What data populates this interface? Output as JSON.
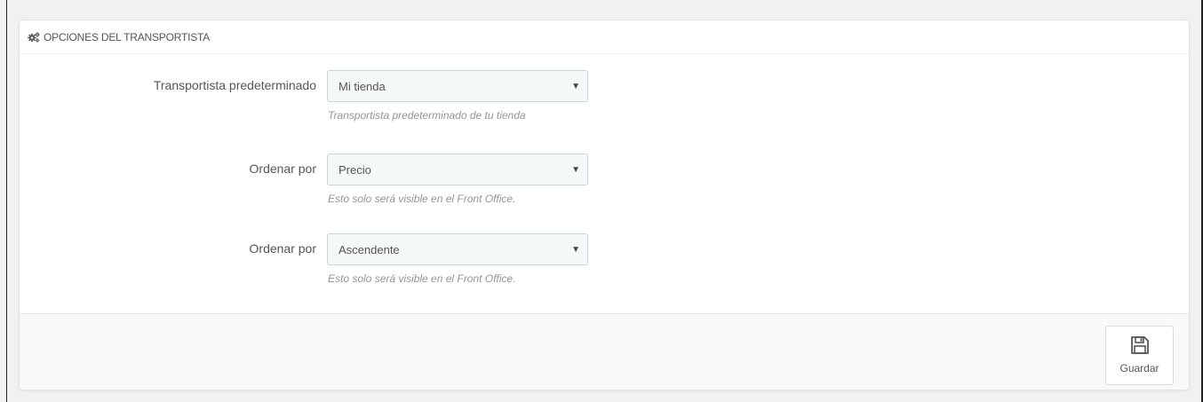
{
  "panel": {
    "title": "OPCIONES DEL TRANSPORTISTA",
    "title_icon": "cogs-icon"
  },
  "fields": [
    {
      "label": "Transportista predeterminado",
      "value": "Mi tienda",
      "help": "Transportista predeterminado de tu tienda"
    },
    {
      "label": "Ordenar por",
      "value": "Precio",
      "help": "Esto solo será visible en el Front Office."
    },
    {
      "label": "Ordenar por",
      "value": "Ascendente",
      "help": "Esto solo será visible en el Front Office."
    }
  ],
  "footer": {
    "save_label": "Guardar",
    "save_icon": "floppy-disk-icon"
  },
  "colors": {
    "background": "#eff1f2",
    "panel_bg": "#ffffff",
    "select_bg": "#f5f8f9",
    "select_border": "#c7d6db",
    "help_text": "#959595",
    "footer_bg": "#f8f9fb"
  }
}
